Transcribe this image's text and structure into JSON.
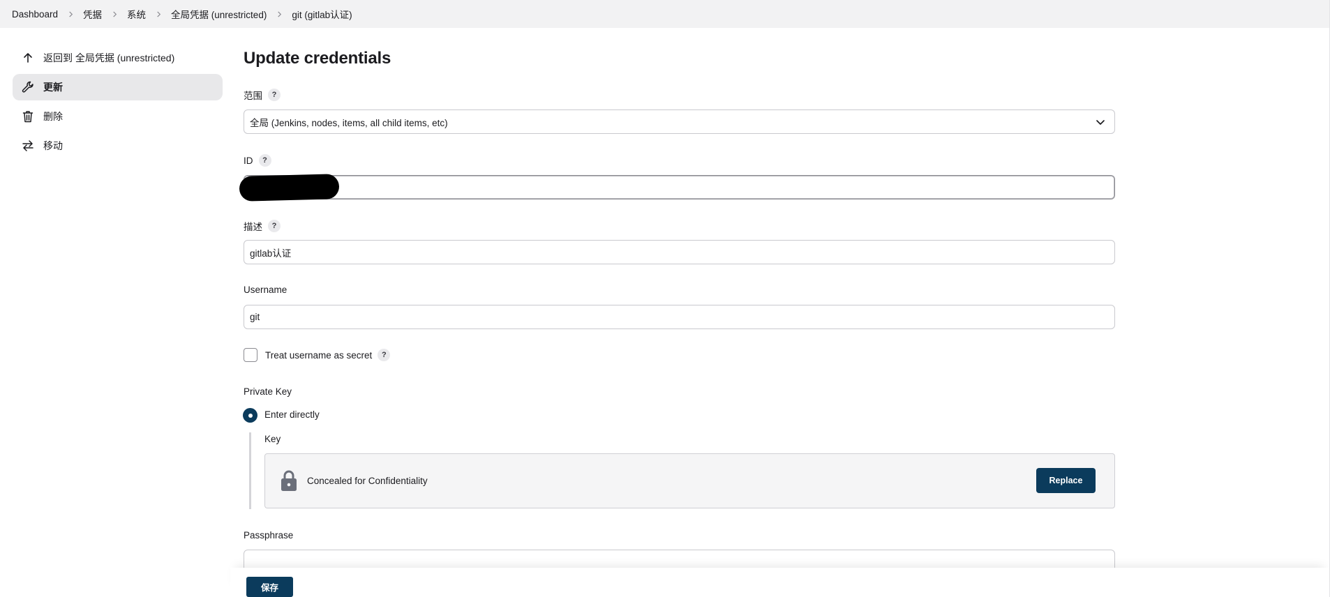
{
  "breadcrumb": {
    "items": [
      "Dashboard",
      "凭据",
      "系统",
      "全局凭据 (unrestricted)",
      "git (gitlab认证)"
    ]
  },
  "sidebar": {
    "items": [
      {
        "label": "返回到 全局凭据 (unrestricted)",
        "icon": "arrow-up-icon"
      },
      {
        "label": "更新",
        "icon": "wrench-icon",
        "active": true
      },
      {
        "label": "删除",
        "icon": "trash-icon"
      },
      {
        "label": "移动",
        "icon": "arrows-swap-icon"
      }
    ]
  },
  "main": {
    "title": "Update credentials",
    "scope": {
      "label": "范围",
      "help": "?",
      "value": "全局 (Jenkins, nodes, items, all child items, etc)"
    },
    "id": {
      "label": "ID",
      "help": "?",
      "value": ""
    },
    "description": {
      "label": "描述",
      "help": "?",
      "value": "gitlab认证"
    },
    "username": {
      "label": "Username",
      "value": "git"
    },
    "treat_secret": {
      "label": "Treat username as secret",
      "help": "?",
      "checked": false
    },
    "private_key": {
      "label": "Private Key",
      "option_label": "Enter directly",
      "key_label": "Key",
      "concealed_text": "Concealed for Confidentiality",
      "replace_label": "Replace"
    },
    "passphrase": {
      "label": "Passphrase",
      "value": ""
    }
  },
  "footer": {
    "save_label": "保存"
  },
  "colors": {
    "primary": "#0b3b5c",
    "active_bg": "#e8e8ea",
    "breadcrumb_bg": "#f2f2f3"
  }
}
